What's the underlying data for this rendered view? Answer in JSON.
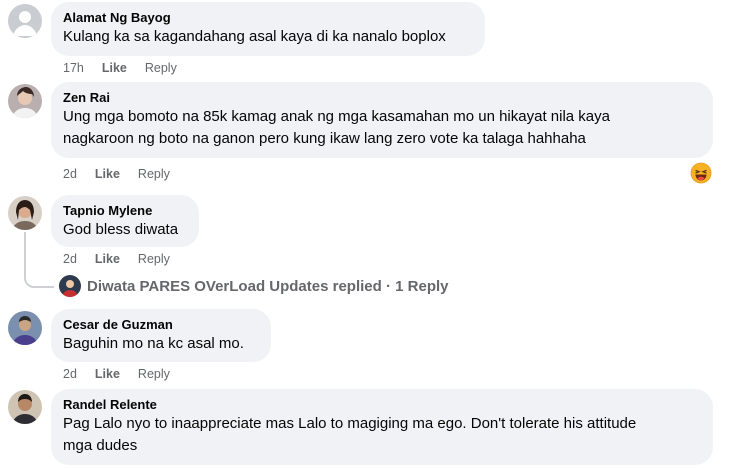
{
  "comments": [
    {
      "name": "Alamat Ng Bayog",
      "text": "Kulang ka sa kagandahang asal kaya di ka nanalo boplox",
      "time": "17h",
      "like": "Like",
      "reply": "Reply"
    },
    {
      "name": "Zen Rai",
      "text": "Ung mga bomoto na 85k kamag anak ng mga kasamahan mo un hikayat nila kaya\nnagkaroon ng boto na ganon pero kung ikaw lang zero vote ka talaga hahhaha",
      "time": "2d",
      "like": "Like",
      "reply": "Reply",
      "reaction": "laughing-emoji"
    },
    {
      "name": "Tapnio Mylene",
      "text": "God bless diwata",
      "time": "2d",
      "like": "Like",
      "reply": "Reply",
      "replies_summary": "Diwata PARES OVerLoad Updates replied · 1 Reply"
    },
    {
      "name": "Cesar de Guzman",
      "text": "Baguhin mo na kc asal mo.",
      "time": "2d",
      "like": "Like",
      "reply": "Reply"
    },
    {
      "name": "Randel Relente",
      "text": "Pag Lalo nyo to inaappreciate mas Lalo to magiging ma ego. Don't tolerate his attitude\nmga dudes"
    }
  ],
  "colors": {
    "bubble": "#f0f2f5",
    "meta": "#65676b",
    "text": "#050505"
  }
}
